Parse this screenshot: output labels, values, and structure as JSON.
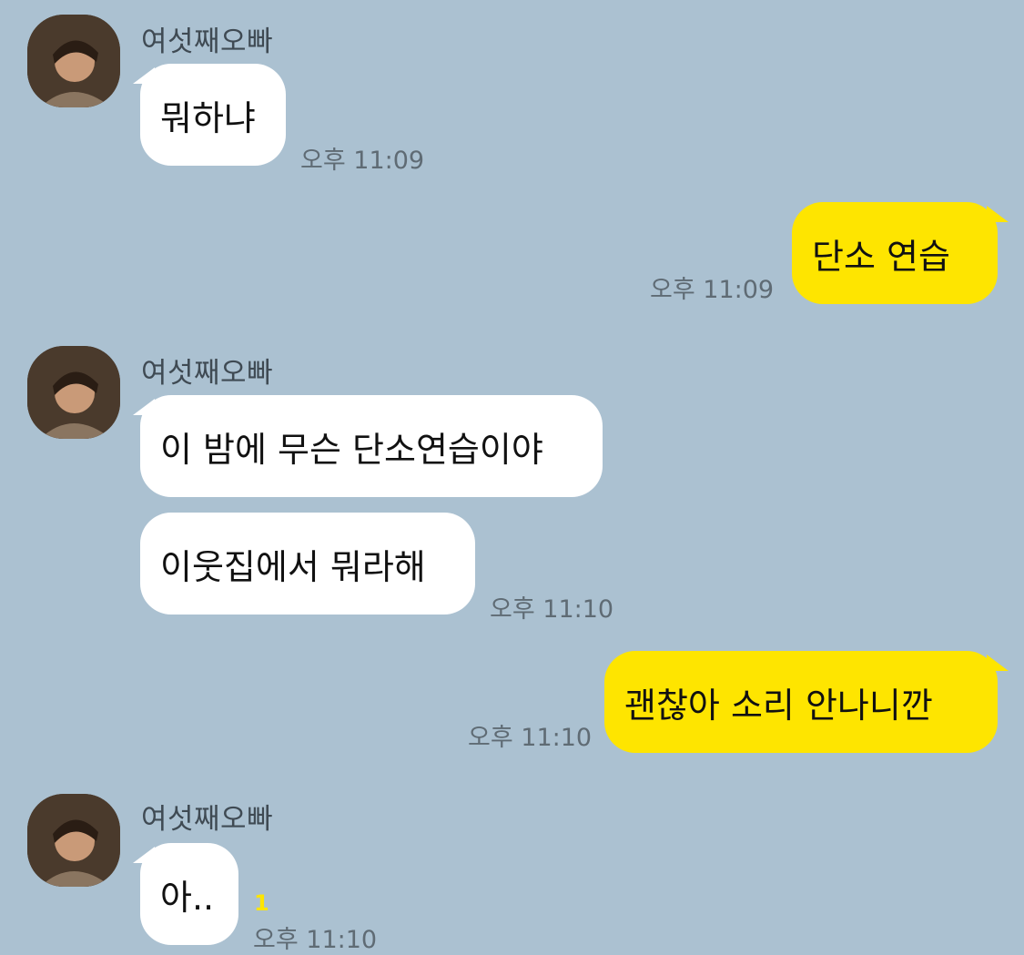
{
  "sender": {
    "name": "여섯째오빠"
  },
  "messages": [
    {
      "text": "뭐하냐",
      "time": "오후 11:09"
    },
    {
      "text": "단소 연습",
      "time": "오후 11:09"
    },
    {
      "text": "이 밤에 무슨 단소연습이야"
    },
    {
      "text": "이웃집에서 뭐라해",
      "time": "오후 11:10"
    },
    {
      "text": "괜찮아 소리 안나니깐",
      "time": "오후 11:10"
    },
    {
      "text": "아..",
      "time": "오후 11:10",
      "unread": "1"
    }
  ],
  "colors": {
    "background": "#abc1d1",
    "incoming_bubble": "#ffffff",
    "outgoing_bubble": "#fee500",
    "unread_badge": "#fee500"
  },
  "icons": {
    "avatar": "profile-photo-avatar"
  }
}
